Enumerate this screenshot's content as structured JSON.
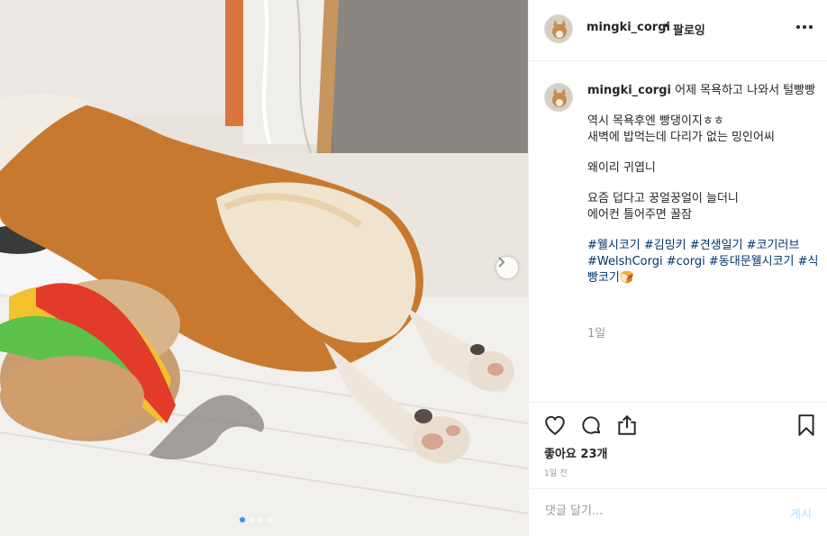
{
  "post": {
    "username": "mingki_corgi",
    "separator": "•",
    "follow_label": "팔로잉",
    "caption": {
      "first_line": "어제 목욕하고 나와서 털빵빵",
      "lines": [
        "역시 목욕후엔 빵댕이지ㅎㅎ",
        "새벽에 밥먹는데 다리가 없는 밍인어씨"
      ],
      "line3": "왜이리 귀엽니",
      "lines2": [
        "요즘 덥다고 꿍얼꿍얼이 늘더니",
        "에어컨 틀어주면 꿀잠"
      ],
      "hashtags": [
        "#웰시코기",
        "#김밍키",
        "#견생일기",
        "#코기러브",
        "#WelshCorgi",
        "#corgi",
        "#동대문웰시코기",
        "#식빵코기"
      ],
      "emoji": "🍞"
    },
    "caption_time": "1일",
    "likes": "좋아요 23개",
    "time_ago": "1일 전",
    "comment_placeholder": "댓글 달기...",
    "post_button": "게시"
  },
  "icons": {
    "more": "more-options-icon",
    "like": "heart-icon",
    "comment": "comment-bubble-icon",
    "share": "share-icon",
    "save": "bookmark-icon",
    "next": "chevron-right-icon"
  },
  "carousel": {
    "total": 4,
    "active": 1
  },
  "colors": {
    "hashtag": "#003569",
    "muted": "#999999",
    "post_disabled": "#b2dffc",
    "active_dot": "#3897f0"
  }
}
